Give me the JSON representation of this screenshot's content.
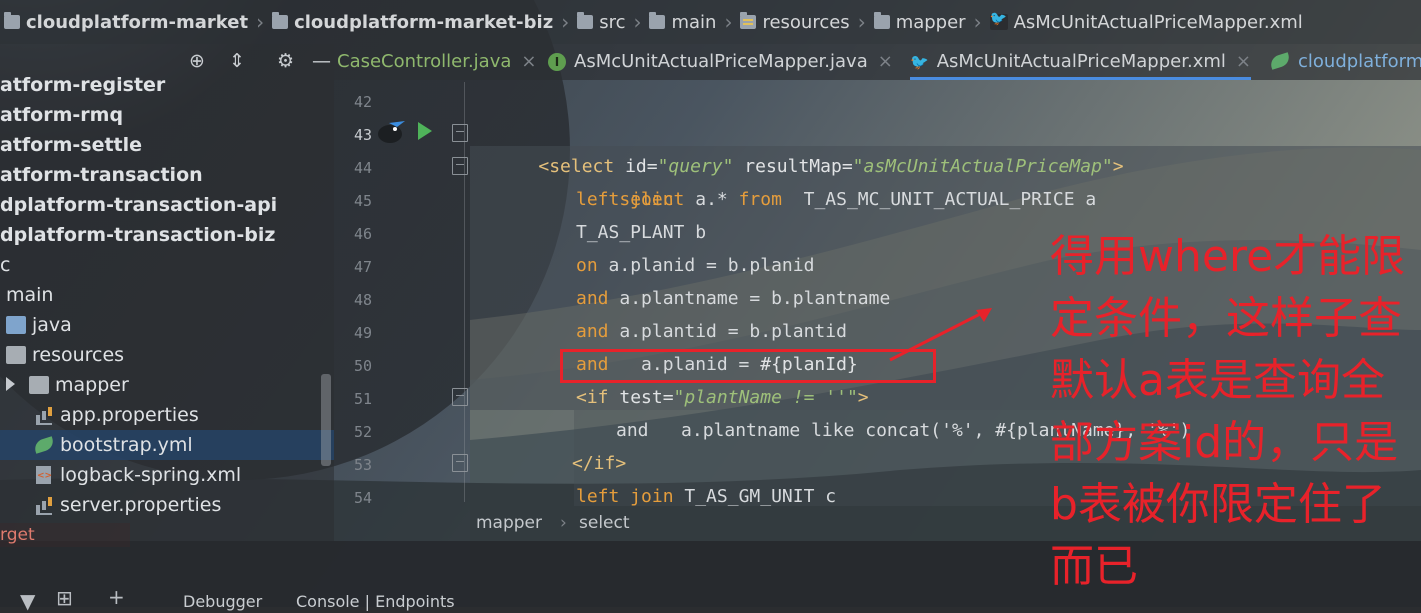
{
  "breadcrumb": {
    "items": [
      {
        "label": "cloudplatform-market",
        "icon": "module-folder-icon"
      },
      {
        "label": "cloudplatform-market-biz",
        "icon": "module-folder-icon"
      },
      {
        "label": "src",
        "icon": "folder-icon"
      },
      {
        "label": "main",
        "icon": "folder-icon"
      },
      {
        "label": "resources",
        "icon": "resources-folder-icon"
      },
      {
        "label": "mapper",
        "icon": "folder-icon"
      },
      {
        "label": "AsMcUnitActualPriceMapper.xml",
        "icon": "mybatis-xml-icon"
      }
    ]
  },
  "project": {
    "toolbar": [
      "crosshair-icon",
      "collapse-icon",
      "gear-icon",
      "minimize-icon"
    ],
    "tree": [
      {
        "label": "atform-register",
        "icon": ""
      },
      {
        "label": "atform-rmq",
        "icon": ""
      },
      {
        "label": "atform-settle",
        "icon": ""
      },
      {
        "label": "atform-transaction",
        "icon": ""
      },
      {
        "label": "dplatform-transaction-api",
        "icon": ""
      },
      {
        "label": "dplatform-transaction-biz",
        "icon": ""
      },
      {
        "label": "c",
        "icon": ""
      },
      {
        "label": "main",
        "icon": ""
      },
      {
        "label": "java",
        "icon": "folder-icon"
      },
      {
        "label": "resources",
        "icon": "resources-folder-icon"
      },
      {
        "label": "mapper",
        "icon": "folder-icon"
      },
      {
        "label": "app.properties",
        "icon": "properties-file-icon"
      },
      {
        "label": "bootstrap.yml",
        "icon": "yml-file-icon"
      },
      {
        "label": "logback-spring.xml",
        "icon": "xml-file-icon"
      },
      {
        "label": "server.properties",
        "icon": "properties-file-icon"
      },
      {
        "label": "rget",
        "icon": ""
      }
    ]
  },
  "tabs": [
    {
      "label": "CaseController.java",
      "icon": ""
    },
    {
      "label": "AsMcUnitActualPriceMapper.java",
      "icon": "interface-icon"
    },
    {
      "label": "AsMcUnitActualPriceMapper.xml",
      "icon": "mybatis-xml-icon",
      "active": true
    },
    {
      "label": "cloudplatform",
      "icon": "spring-leaf-icon"
    }
  ],
  "close_glyph": "×",
  "line_numbers": [
    "42",
    "43",
    "44",
    "45",
    "46",
    "47",
    "48",
    "49",
    "50",
    "51",
    "52",
    "53",
    "54"
  ],
  "code": {
    "l43": {
      "open": "<select",
      "id_attr": "id=",
      "id_val": "\"query\"",
      "rm_attr": "resultMap=",
      "rm_val": "\"asMcUnitActualPriceMap\"",
      "close": ">"
    },
    "l44": {
      "kw1": "select",
      "t1": " a.* ",
      "kw2": "from",
      "t2": "  T_AS_MC_UNIT_ACTUAL_PRICE a"
    },
    "l45": {
      "kw": "left join"
    },
    "l46": {
      "text": "T_AS_PLANT b"
    },
    "l47": {
      "kw": "on",
      "text": " a.planid = b.planid"
    },
    "l48": {
      "kw": "and",
      "text": " a.plantname = b.plantname"
    },
    "l49": {
      "kw": "and",
      "text": " a.plantid = b.plantid"
    },
    "l50": {
      "kw": "and",
      "text": "   a.planid = ",
      "ph": "#{planId}"
    },
    "l51": {
      "open": "<if",
      "attr": " test=",
      "val": "\"plantName != ''\"",
      "close": ">"
    },
    "l52": {
      "text": "and   a.plantname like concat('%', #{plantName}, '%')"
    },
    "l53": {
      "tag": "</if>"
    },
    "l54": {
      "kw": "left join",
      "text": " T_AS_GM_UNIT c"
    }
  },
  "annotation": {
    "text": "得用where才能限定条件，这样子查默认a表是查询全部方案id的，只是b表被你限定住了而已",
    "color": "#e8222a"
  },
  "editor_breadcrumb": [
    "mapper",
    "select"
  ],
  "bottom": {
    "tabs": [
      "Debugger",
      "Console | Endpoints"
    ],
    "icons": [
      "filter-icon",
      "add-watch-icon",
      "plus-icon"
    ]
  }
}
